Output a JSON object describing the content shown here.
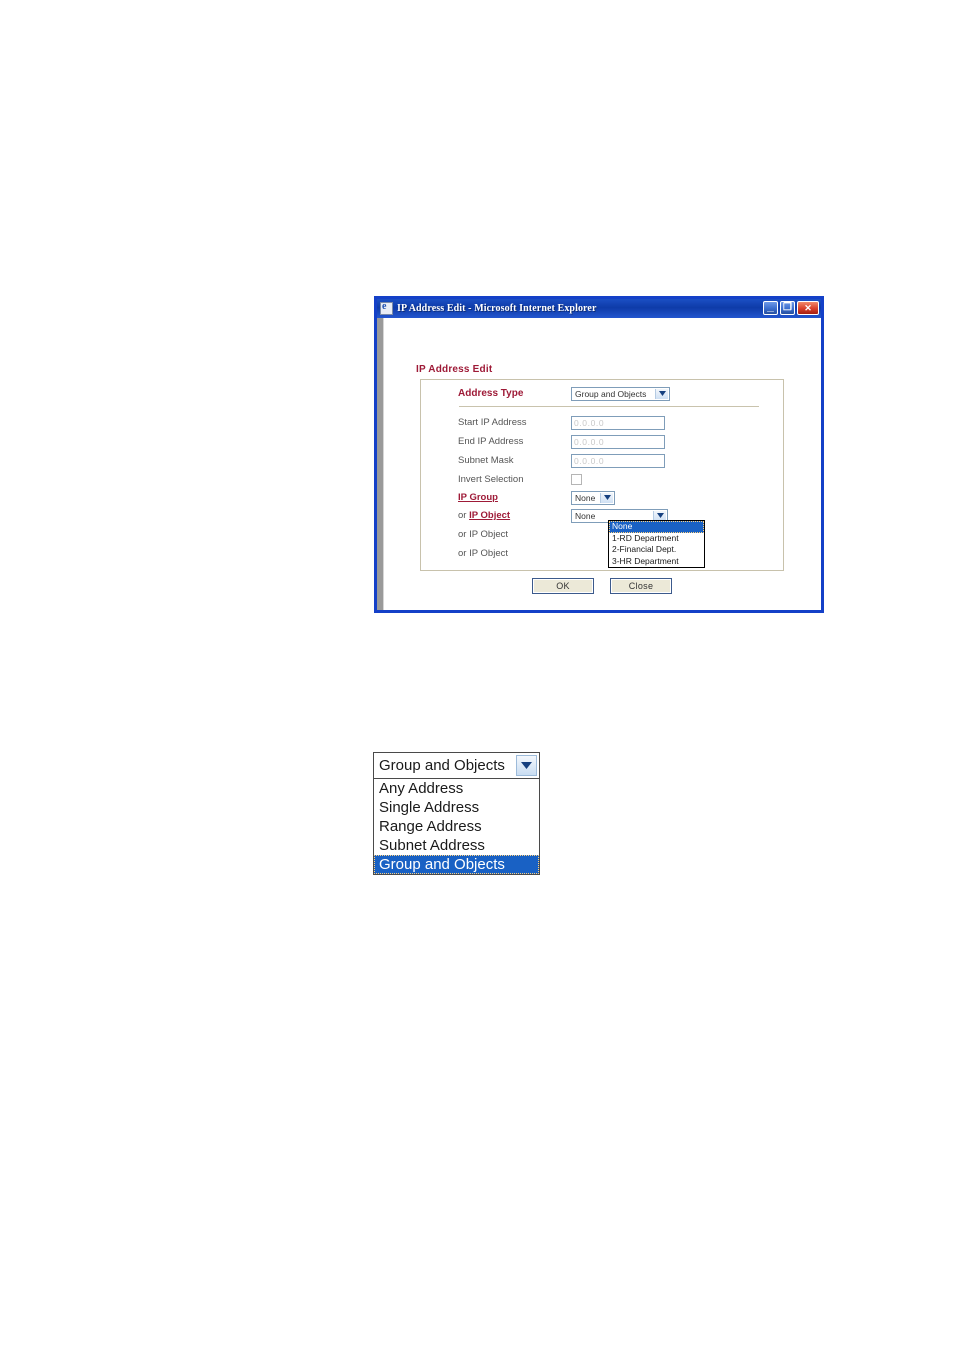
{
  "window": {
    "title": "IP Address Edit - Microsoft Internet Explorer",
    "icon": "ie-document-icon",
    "minimize_label": "_",
    "maximize_label": "❐",
    "close_label": "✕"
  },
  "page": {
    "heading": "IP Address Edit",
    "rows": [
      {
        "label": "Address Type",
        "type": "select",
        "value": "Group and Objects",
        "accent": true,
        "link": false
      },
      {
        "label": "Start IP Address",
        "type": "text",
        "value": "0.0.0.0",
        "accent": false,
        "link": false
      },
      {
        "label": "End IP Address",
        "type": "text",
        "value": "0.0.0.0",
        "accent": false,
        "link": false
      },
      {
        "label": "Subnet Mask",
        "type": "text",
        "value": "0.0.0.0",
        "accent": false,
        "link": false
      },
      {
        "label": "Invert Selection",
        "type": "checkbox",
        "value": "",
        "accent": false,
        "link": false
      },
      {
        "label": "IP Group",
        "type": "select",
        "value": "None",
        "accent": true,
        "link": true
      },
      {
        "label": "or IP Object",
        "prefix": "or ",
        "link_text": "IP Object",
        "type": "select",
        "value": "None",
        "accent": true,
        "link": true
      },
      {
        "label": "or IP Object",
        "type": "none",
        "value": "",
        "accent": false,
        "link": false
      },
      {
        "label": "or IP Object",
        "type": "none",
        "value": "",
        "accent": false,
        "link": false
      }
    ],
    "ip_object_options": [
      "None",
      "1-RD Department",
      "2-Financial Dept.",
      "3-HR Department"
    ],
    "ip_object_selected": "None",
    "buttons": {
      "ok": "OK",
      "close": "Close"
    }
  },
  "address_type_dropdown": {
    "value": "Group and Objects",
    "options": [
      "Any Address",
      "Single Address",
      "Range Address",
      "Subnet Address",
      "Group and Objects"
    ],
    "selected": "Group and Objects"
  },
  "colors": {
    "accent_red": "#9e1a37",
    "title_blue": "#0e3ba8",
    "window_border": "#1440c8",
    "highlight_blue": "#1961c4",
    "form_border": "#c8c2ac"
  }
}
